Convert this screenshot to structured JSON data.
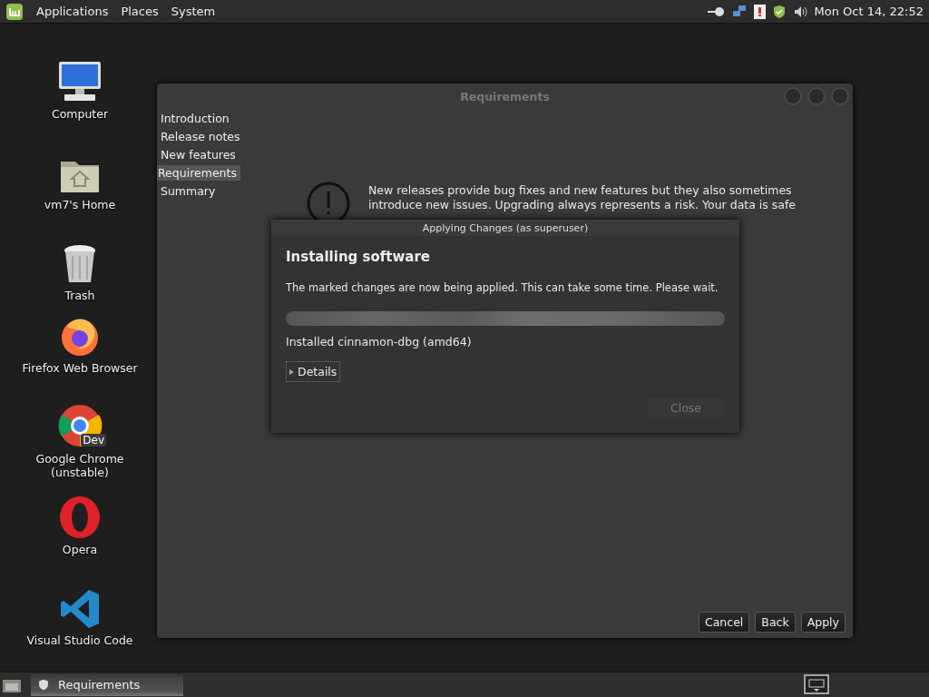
{
  "top_panel": {
    "menus": [
      "Applications",
      "Places",
      "System"
    ],
    "clock": "Mon Oct 14, 22:52"
  },
  "desktop_icons": [
    {
      "kind": "computer",
      "label": "Computer"
    },
    {
      "kind": "home",
      "label": "vm7's Home"
    },
    {
      "kind": "trash",
      "label": "Trash"
    },
    {
      "kind": "firefox",
      "label": "Firefox Web Browser"
    },
    {
      "kind": "chrome",
      "label": "Google Chrome\n(unstable)",
      "badge": "Dev"
    },
    {
      "kind": "opera",
      "label": "Opera"
    },
    {
      "kind": "vscode",
      "label": "Visual Studio Code"
    }
  ],
  "window": {
    "title": "Requirements",
    "steps": [
      {
        "label": "Introduction",
        "selected": false
      },
      {
        "label": "Release notes",
        "selected": false
      },
      {
        "label": "New features",
        "selected": false
      },
      {
        "label": "Requirements",
        "selected": true
      },
      {
        "label": "Summary",
        "selected": false
      }
    ],
    "message": [
      "New releases provide bug fixes and new features but they also sometimes",
      "introduce new issues. Upgrading always represents a risk. Your data is safe"
    ],
    "buttons": [
      "Cancel",
      "Back",
      "Apply"
    ]
  },
  "dialog": {
    "title": "Applying Changes (as superuser)",
    "heading": "Installing software",
    "message": "The marked changes are now being applied. This can take some time. Please wait.",
    "progress": {
      "level": 1
    },
    "status": "Installed cinnamon-dbg (amd64)",
    "details": {
      "label": "Details",
      "expanded": false
    },
    "close": {
      "label": "Close",
      "disabled": true
    }
  },
  "taskbar": {
    "tasks": [
      {
        "label": "Requirements",
        "selected": true
      }
    ]
  }
}
